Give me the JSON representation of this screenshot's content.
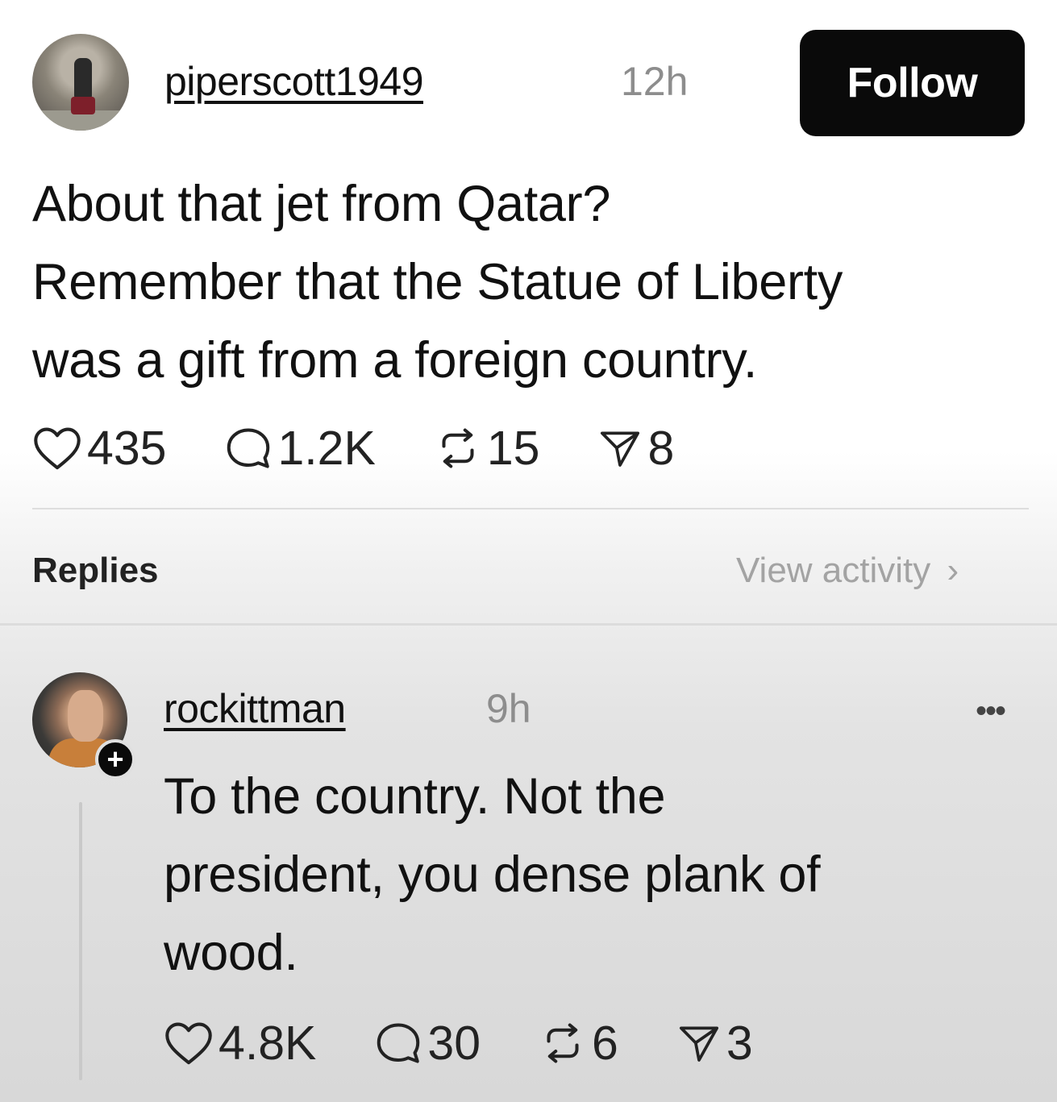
{
  "post": {
    "username": "piperscott1949",
    "time": "12h",
    "follow_label": "Follow",
    "body_lines": [
      "About that jet from Qatar?",
      "Remember that the Statue of Liberty",
      "was a gift from a foreign country."
    ],
    "stats": {
      "likes": "435",
      "comments": "1.2K",
      "reposts": "15",
      "shares": "8"
    }
  },
  "replies_section": {
    "heading": "Replies",
    "view_activity": "View activity"
  },
  "reply": {
    "username": "rockittman",
    "time": "9h",
    "body_lines": [
      "To the country. Not the",
      "president, you dense plank of",
      "wood."
    ],
    "stats": {
      "likes": "4.8K",
      "comments": "30",
      "reposts": "6",
      "shares": "3"
    }
  },
  "icons": {
    "like": "heart-icon",
    "comment": "comment-bubble-icon",
    "repost": "repost-icon",
    "share": "send-icon",
    "more": "more-horizontal-icon",
    "follow_plus": "plus-icon",
    "chevron": "chevron-right-icon"
  },
  "colors": {
    "follow_button": "#0a0a0a",
    "muted_text": "#8d8d8d"
  }
}
